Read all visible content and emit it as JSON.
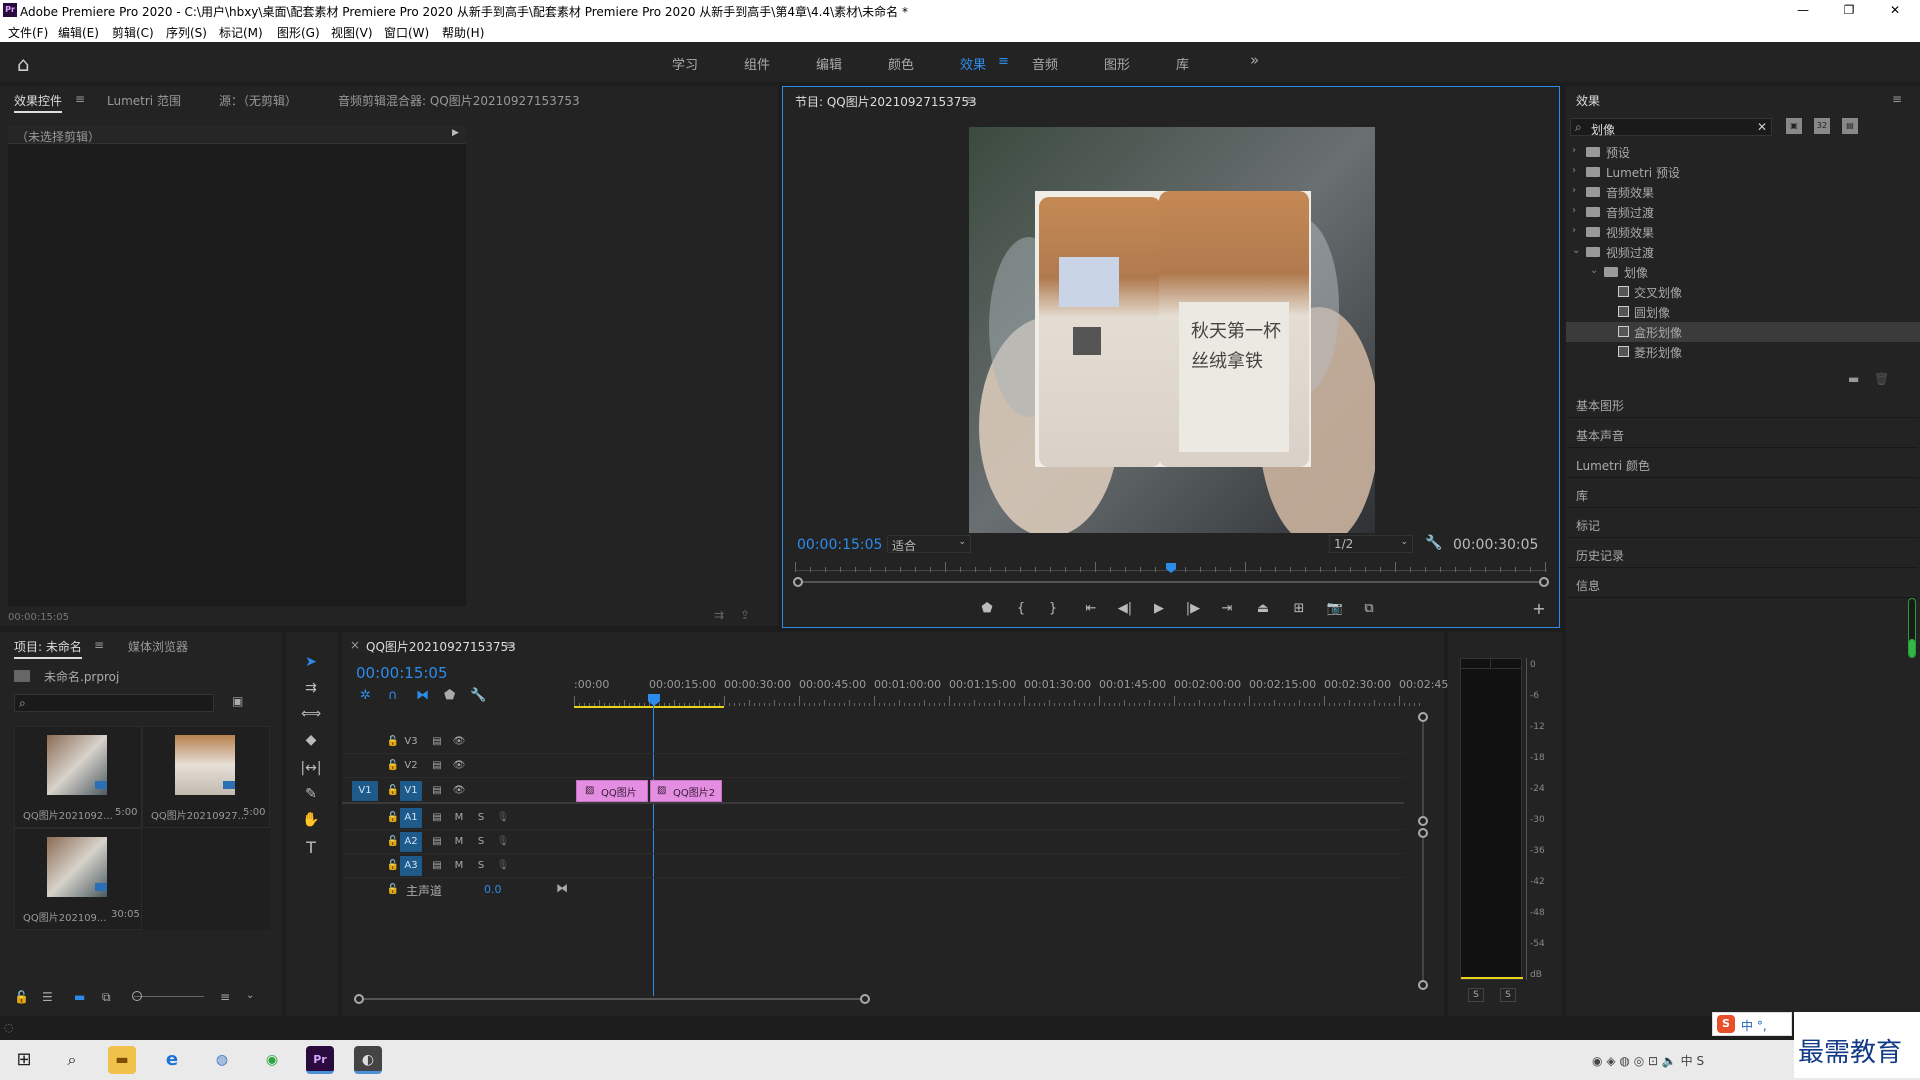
{
  "window": {
    "title": "Adobe Premiere Pro 2020 - C:\\用户\\hbxy\\桌面\\配套素材 Premiere Pro 2020 从新手到高手\\配套素材 Premiere Pro 2020 从新手到高手\\第4章\\4.4\\素材\\未命名 *",
    "app_badge": "Pr",
    "min": "—",
    "max": "❐",
    "close": "✕"
  },
  "menu": [
    "文件(F)",
    "编辑(E)",
    "剪辑(C)",
    "序列(S)",
    "标记(M)",
    "图形(G)",
    "视图(V)",
    "窗口(W)",
    "帮助(H)"
  ],
  "workspaces": [
    {
      "label": "学习",
      "active": false
    },
    {
      "label": "组件",
      "active": false
    },
    {
      "label": "编辑",
      "active": false
    },
    {
      "label": "颜色",
      "active": false
    },
    {
      "label": "效果",
      "active": true
    },
    {
      "label": "音频",
      "active": false
    },
    {
      "label": "图形",
      "active": false
    },
    {
      "label": "库",
      "active": false
    }
  ],
  "ws_more": "»",
  "ws_menu": "≡",
  "home_icon": "⌂",
  "source_panel": {
    "tabs": [
      "效果控件",
      "Lumetri 范围",
      "源：（无剪辑）",
      "音频剪辑混合器: QQ图片20210927153753"
    ],
    "tab_menu": "≡",
    "no_clip": "（未选择剪辑）",
    "timecode": "00:00:15:05"
  },
  "program": {
    "title": "节目: QQ图片20210927153753",
    "menu": "≡",
    "timecode_in": "00:00:15:05",
    "fit": "适合",
    "resolution": "1/2",
    "timecode_out": "00:00:30:05",
    "playhead_fraction": 0.5
  },
  "effects_panel": {
    "title": "效果",
    "menu": "≡",
    "search": "划像",
    "clear": "✕",
    "tree": [
      {
        "label": "预设",
        "level": 0,
        "type": "folder-special",
        "expanded": false
      },
      {
        "label": "Lumetri 预设",
        "level": 0,
        "type": "folder-special",
        "expanded": false
      },
      {
        "label": "音频效果",
        "level": 0,
        "type": "folder",
        "expanded": false
      },
      {
        "label": "音频过渡",
        "level": 0,
        "type": "folder",
        "expanded": false
      },
      {
        "label": "视频效果",
        "level": 0,
        "type": "folder",
        "expanded": false
      },
      {
        "label": "视频过渡",
        "level": 0,
        "type": "folder",
        "expanded": true
      },
      {
        "label": "划像",
        "level": 1,
        "type": "folder",
        "expanded": true
      },
      {
        "label": "交叉划像",
        "level": 2,
        "type": "effect",
        "selected": false
      },
      {
        "label": "圆划像",
        "level": 2,
        "type": "effect",
        "selected": false
      },
      {
        "label": "盒形划像",
        "level": 2,
        "type": "effect",
        "selected": true
      },
      {
        "label": "菱形划像",
        "level": 2,
        "type": "effect",
        "selected": false
      }
    ],
    "sections": [
      "基本图形",
      "基本声音",
      "Lumetri 颜色",
      "库",
      "标记",
      "历史记录",
      "信息"
    ]
  },
  "project_panel": {
    "tabs": [
      "项目: 未命名",
      "媒体浏览器"
    ],
    "tab_menu": "≡",
    "file": "未命名.prproj",
    "items": [
      {
        "name": "QQ图片2021092...",
        "duration": "5:00"
      },
      {
        "name": "QQ图片20210927...",
        "duration": "5:00"
      },
      {
        "name": "QQ图片202109...",
        "duration": "30:05"
      }
    ]
  },
  "timeline": {
    "close": "×",
    "title": "QQ图片20210927153753",
    "menu": "≡",
    "timecode": "00:00:15:05",
    "ruler": [
      ":00:00",
      "00:00:15:00",
      "00:00:30:00",
      "00:00:45:00",
      "00:01:00:00",
      "00:01:15:00",
      "00:01:30:00",
      "00:01:45:00",
      "00:02:00:00",
      "00:02:15:00",
      "00:02:30:00",
      "00:02:45:"
    ],
    "video_tracks": [
      "V3",
      "V2",
      "V1"
    ],
    "audio_tracks": [
      "A1",
      "A2",
      "A3"
    ],
    "source_patch": "V1",
    "master_label": "主声道",
    "master_value": "0.0",
    "track_m": "M",
    "track_s": "S",
    "clips": [
      {
        "label": "QQ图片",
        "track": "V1"
      },
      {
        "label": "QQ图片2",
        "track": "V1"
      }
    ]
  },
  "vu_meter": {
    "ticks": [
      "0",
      "-6",
      "-12",
      "-18",
      "-24",
      "-30",
      "-36",
      "-42",
      "-48",
      "-54",
      "dB"
    ],
    "solo": [
      "S",
      "S"
    ]
  },
  "ime": {
    "label": "中 °,"
  },
  "watermark": "最需教育",
  "colors": {
    "accent": "#2d8ceb",
    "clip": "#e38ee0",
    "selected": "#3b3b3b"
  }
}
